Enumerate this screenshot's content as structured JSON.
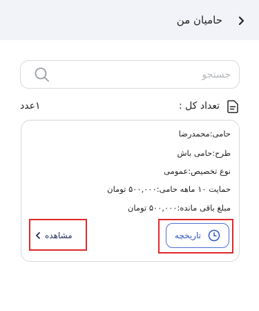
{
  "header": {
    "title": "حامیان من",
    "back_icon": "chevron-right-icon"
  },
  "search": {
    "placeholder": "جستجو",
    "value": "",
    "icon": "search-icon"
  },
  "summary": {
    "count_label": "تعداد کل :",
    "count_value": "۱عدد",
    "icon": "document-icon"
  },
  "card": {
    "sponsor": "حامی:محمدرضا",
    "plan": "طرح:حامی باش",
    "allocation": "نوع تخصیص:عمومی",
    "support": "حمایت ۱۰ ماهه حامی:۵۰۰,۰۰۰ تومان",
    "remaining": "مبلغ باقی مانده:۵۰۰,۰۰۰ تومان",
    "history_label": "تاریخچه",
    "history_icon": "clock-icon",
    "view_label": "مشاهده",
    "view_icon": "chevron-left-icon"
  },
  "colors": {
    "header_bg": "#f2f3f8",
    "accent": "#2f55c4",
    "highlight": "#e02727"
  }
}
